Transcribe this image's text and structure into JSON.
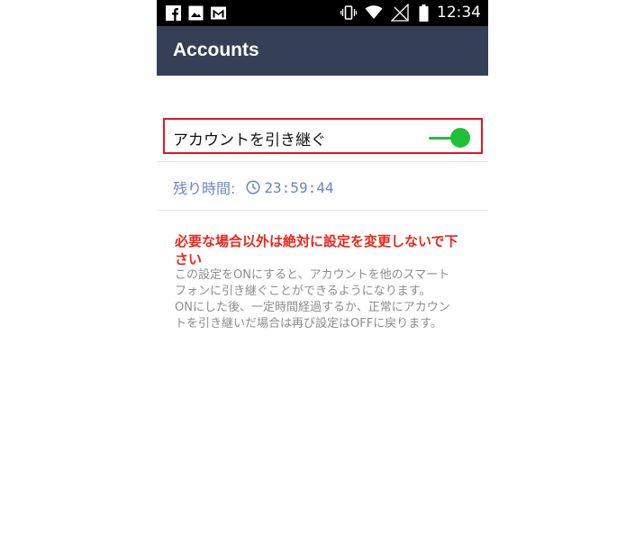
{
  "status_bar": {
    "time": "12:34",
    "left_icons": [
      "facebook-icon",
      "image-icon",
      "gmail-icon"
    ],
    "right_icons": [
      "vibrate-icon",
      "wifi-icon",
      "no-signal-icon",
      "battery-icon"
    ]
  },
  "app_bar": {
    "title": "Accounts"
  },
  "transfer": {
    "label": "アカウントを引き継ぐ",
    "enabled": true,
    "accent_color": "#20c03a",
    "highlight_color": "#e8141c"
  },
  "remaining": {
    "label": "残り時間:",
    "time": "23:59:44",
    "color": "#6a86c0"
  },
  "warning": {
    "title": "必要な場合以外は絶対に設定を変更しないで下さい",
    "lines": [
      "この設定をONにすると、アカウントを他のスマート",
      "フォンに引き継ぐことができるようになります。",
      "ONにした後、一定時間経過するか、正常にアカウン",
      "トを引き継いだ場合は再び設定はOFFに戻ります。"
    ]
  }
}
